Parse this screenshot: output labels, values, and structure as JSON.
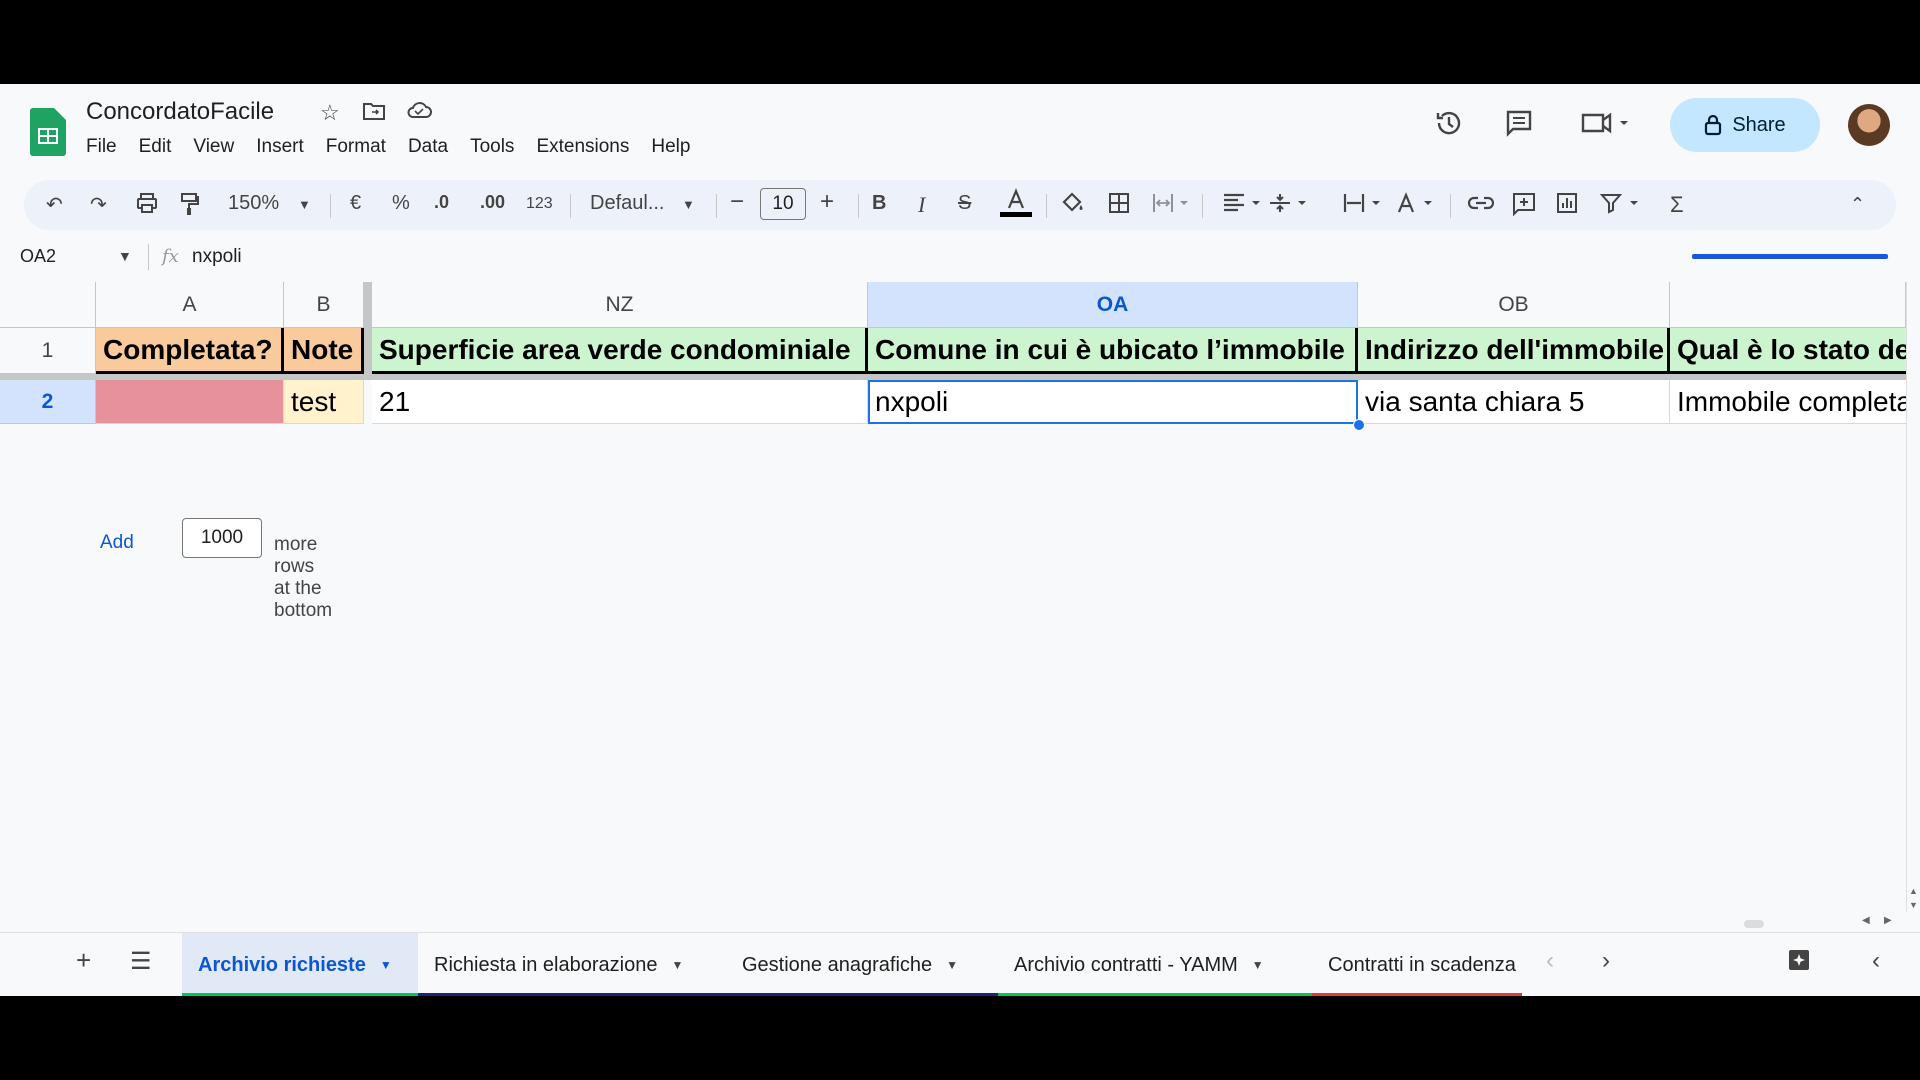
{
  "app": {
    "doc_title": "ConcordatoFacile",
    "share_label": "Share"
  },
  "menu": [
    "File",
    "Edit",
    "View",
    "Insert",
    "Format",
    "Data",
    "Tools",
    "Extensions",
    "Help"
  ],
  "toolbar": {
    "zoom": "150%",
    "currency": "€",
    "percent": "%",
    "dec_decrease": ".0",
    "dec_increase": ".00",
    "number_format": "123",
    "font": "Defaul...",
    "font_size": "10"
  },
  "formula_bar": {
    "cell_ref": "OA2",
    "fx": "fx",
    "value": "nxpoli"
  },
  "columns": [
    "A",
    "B",
    "NZ",
    "OA",
    "OB"
  ],
  "rows": [
    "1",
    "2"
  ],
  "header_row": [
    "Completata?",
    "Note",
    "Superficie area verde condominiale",
    "Comune in cui è ubicato l’immobile",
    "Indirizzo dell'immobile",
    "Qual è lo stato dell'immobile"
  ],
  "data_row": [
    "",
    "test",
    "21",
    "nxpoli",
    "via santa chiara 5",
    "Immobile completato"
  ],
  "add_rows": {
    "link": "Add",
    "count": "1000",
    "suffix": "more rows at the bottom"
  },
  "sheets": [
    {
      "name": "Archivio richieste",
      "color": "#00c853"
    },
    {
      "name": "Richiesta in elaborazione",
      "color": "#1a237e"
    },
    {
      "name": "Gestione anagrafiche",
      "color": "#1a237e"
    },
    {
      "name": "Archivio contratti - YAMM",
      "color": "#00c853"
    },
    {
      "name": "Contratti in scadenza",
      "color": "#e53935"
    }
  ],
  "colors": {
    "header_green": "#ccf5cf",
    "completata_orange": "#f9cb9c",
    "note_yellow": "#fff2cc",
    "completata_pink": "#e6919c",
    "selection_blue": "#1a73e8"
  }
}
